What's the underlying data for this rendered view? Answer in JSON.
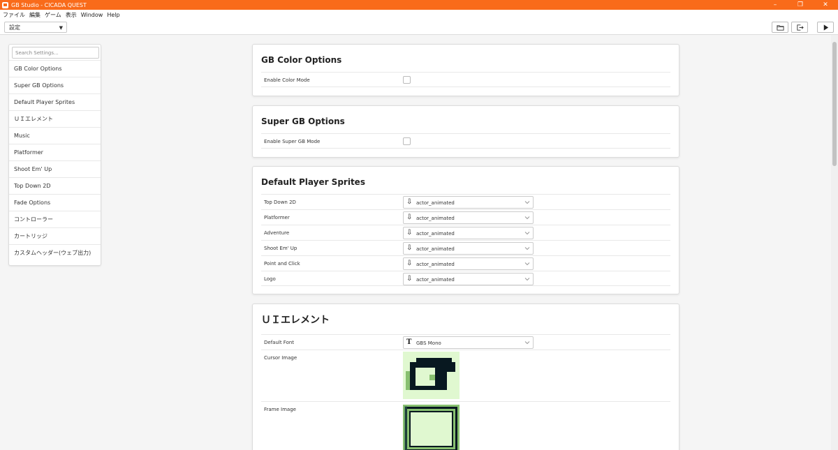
{
  "window": {
    "title": "GB Studio - CICADA QUEST",
    "controls": {
      "minimize": "–",
      "maximize": "❐",
      "close": "✕"
    }
  },
  "menu": [
    "ファイル",
    "編集",
    "ゲーム",
    "表示",
    "Window",
    "Help"
  ],
  "toolbar": {
    "section_select": "設定",
    "icons": [
      "folder-icon",
      "export-icon",
      "play-icon"
    ]
  },
  "sidebar": {
    "search_placeholder": "Search Settings...",
    "items": [
      "GB Color Options",
      "Super GB Options",
      "Default Player Sprites",
      "ＵＩエレメント",
      "Music",
      "Platformer",
      "Shoot Em' Up",
      "Top Down 2D",
      "Fade Options",
      "コントローラー",
      "カートリッジ",
      "カスタムヘッダー(ウェブ出力)"
    ]
  },
  "sections": {
    "color": {
      "title": "GB Color Options",
      "rows": [
        {
          "label": "Enable Color Mode",
          "checked": false
        }
      ]
    },
    "sgb": {
      "title": "Super GB Options",
      "rows": [
        {
          "label": "Enable Super GB Mode",
          "checked": false
        }
      ]
    },
    "sprites": {
      "title": "Default Player Sprites",
      "rows": [
        {
          "label": "Top Down 2D",
          "value": "actor_animated"
        },
        {
          "label": "Platformer",
          "value": "actor_animated"
        },
        {
          "label": "Adventure",
          "value": "actor_animated"
        },
        {
          "label": "Shoot Em' Up",
          "value": "actor_animated"
        },
        {
          "label": "Point and Click",
          "value": "actor_animated"
        },
        {
          "label": "Logo",
          "value": "actor_animated"
        }
      ]
    },
    "ui": {
      "title": "ＵＩエレメント",
      "font": {
        "label": "Default Font",
        "value": "GBS Mono",
        "icon": "T"
      },
      "cursor_label": "Cursor Image",
      "frame_label": "Frame Image"
    }
  },
  "colors": {
    "accent": "#f96b1a",
    "gb_lightest": "#e0f8d0",
    "gb_light": "#88c070",
    "gb_dark": "#346856",
    "gb_darkest": "#081820"
  }
}
